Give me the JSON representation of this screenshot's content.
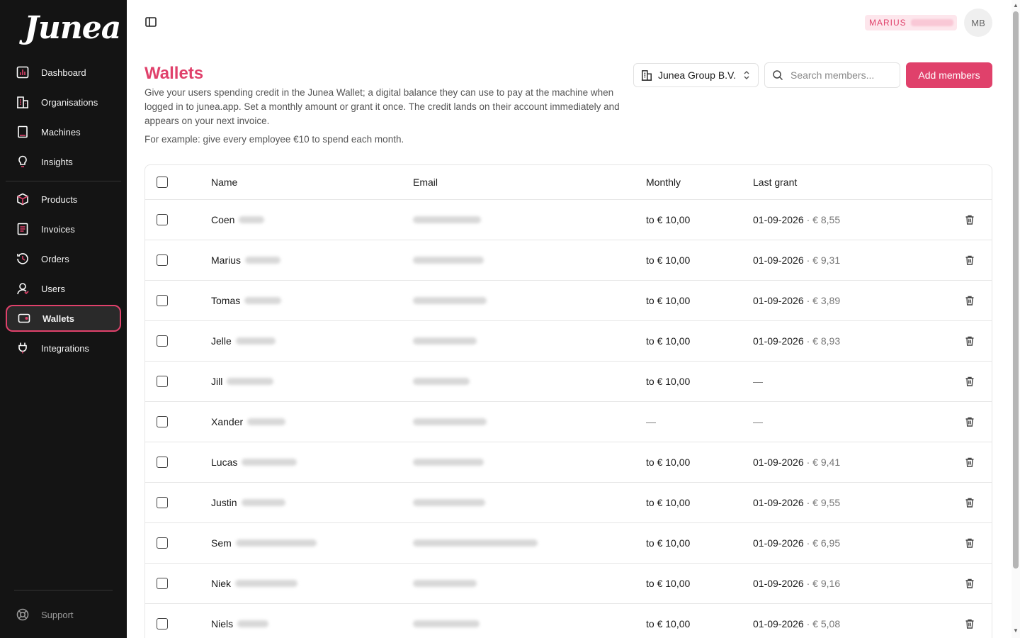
{
  "brand": {
    "logo_text": "Junea",
    "accent": "#e0416b"
  },
  "sidebar": {
    "items": [
      {
        "label": "Dashboard",
        "icon": "bar-chart-icon"
      },
      {
        "label": "Organisations",
        "icon": "building-icon"
      },
      {
        "label": "Machines",
        "icon": "machine-icon"
      },
      {
        "label": "Insights",
        "icon": "lightbulb-icon"
      },
      {
        "label": "Products",
        "icon": "box-icon"
      },
      {
        "label": "Invoices",
        "icon": "receipt-icon"
      },
      {
        "label": "Orders",
        "icon": "history-icon"
      },
      {
        "label": "Users",
        "icon": "user-icon"
      },
      {
        "label": "Wallets",
        "icon": "wallet-icon",
        "active": true
      },
      {
        "label": "Integrations",
        "icon": "plug-icon"
      }
    ],
    "support_label": "Support"
  },
  "topbar": {
    "user_name": "MARIUS",
    "avatar_initials": "MB"
  },
  "header": {
    "title": "Wallets",
    "description": "Give your users spending credit in the Junea Wallet; a digital balance they can use to pay at the machine when logged in to junea.app. Set a monthly amount or grant it once. The credit lands on their account immediately and appears on your next invoice.",
    "example": "For example: give every employee €10 to spend each month.",
    "org_select": "Junea Group B.V.",
    "search_placeholder": "Search members...",
    "add_button": "Add members"
  },
  "table": {
    "columns": [
      "Name",
      "Email",
      "Monthly",
      "Last grant"
    ],
    "rows": [
      {
        "name": "Coen",
        "monthly": "to € 10,00",
        "last_grant_date": "01-09-2026",
        "last_grant_amount": "· € 8,55"
      },
      {
        "name": "Marius",
        "monthly": "to € 10,00",
        "last_grant_date": "01-09-2026",
        "last_grant_amount": "· € 9,31"
      },
      {
        "name": "Tomas",
        "monthly": "to € 10,00",
        "last_grant_date": "01-09-2026",
        "last_grant_amount": "· € 3,89"
      },
      {
        "name": "Jelle",
        "monthly": "to € 10,00",
        "last_grant_date": "01-09-2026",
        "last_grant_amount": "· € 8,93"
      },
      {
        "name": "Jill",
        "monthly": "to € 10,00",
        "last_grant_date": "—",
        "last_grant_amount": ""
      },
      {
        "name": "Xander",
        "monthly": "—",
        "last_grant_date": "—",
        "last_grant_amount": ""
      },
      {
        "name": "Lucas",
        "monthly": "to € 10,00",
        "last_grant_date": "01-09-2026",
        "last_grant_amount": "· € 9,41"
      },
      {
        "name": "Justin",
        "monthly": "to € 10,00",
        "last_grant_date": "01-09-2026",
        "last_grant_amount": "· € 9,55"
      },
      {
        "name": "Sem",
        "monthly": "to € 10,00",
        "last_grant_date": "01-09-2026",
        "last_grant_amount": "· € 6,95"
      },
      {
        "name": "Niek",
        "monthly": "to € 10,00",
        "last_grant_date": "01-09-2026",
        "last_grant_amount": "· € 9,16"
      },
      {
        "name": "Niels",
        "monthly": "to € 10,00",
        "last_grant_date": "01-09-2026",
        "last_grant_amount": "· € 5,08"
      }
    ]
  }
}
